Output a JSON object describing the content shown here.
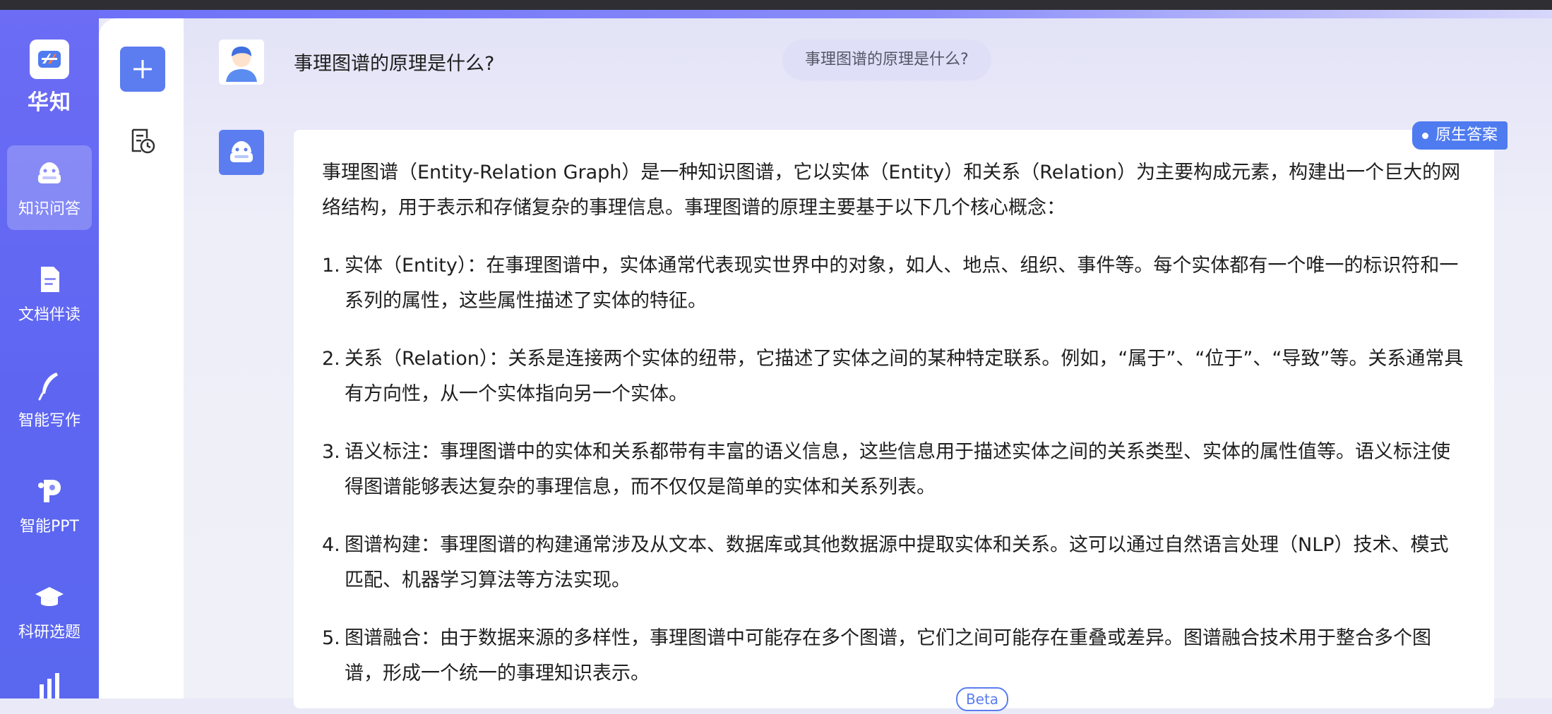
{
  "brand": {
    "name": "华知"
  },
  "sidebar": {
    "items": [
      {
        "label": "知识问答",
        "icon": "robot-icon",
        "active": true
      },
      {
        "label": "文档伴读",
        "icon": "document-icon"
      },
      {
        "label": "智能写作",
        "icon": "feather-pen-icon"
      },
      {
        "label": "智能PPT",
        "icon": "ppt-icon"
      },
      {
        "label": "科研选题",
        "icon": "graduation-cap-icon"
      }
    ]
  },
  "rail": {
    "new_icon": "plus-icon",
    "history_icon": "history-icon"
  },
  "conversation": {
    "question": "事理图谱的原理是什么?",
    "question_pill": "事理图谱的原理是什么?",
    "badge": "原生答案",
    "intro": "事理图谱（Entity-Relation Graph）是一种知识图谱，它以实体（Entity）和关系（Relation）为主要构成元素，构建出一个巨大的网络结构，用于表示和存储复杂的事理信息。事理图谱的原理主要基于以下几个核心概念：",
    "points": [
      {
        "num": "1.",
        "text": "实体（Entity）：在事理图谱中，实体通常代表现实世界中的对象，如人、地点、组织、事件等。每个实体都有一个唯一的标识符和一系列的属性，这些属性描述了实体的特征。"
      },
      {
        "num": "2.",
        "text": "关系（Relation）：关系是连接两个实体的纽带，它描述了实体之间的某种特定联系。例如，“属于”、“位于”、“导致”等。关系通常具有方向性，从一个实体指向另一个实体。"
      },
      {
        "num": "3.",
        "text": "语义标注：事理图谱中的实体和关系都带有丰富的语义信息，这些信息用于描述实体之间的关系类型、实体的属性值等。语义标注使得图谱能够表达复杂的事理信息，而不仅仅是简单的实体和关系列表。"
      },
      {
        "num": "4.",
        "text": "图谱构建：事理图谱的构建通常涉及从文本、数据库或其他数据源中提取实体和关系。这可以通过自然语言处理（NLP）技术、模式匹配、机器学习算法等方法实现。"
      },
      {
        "num": "5.",
        "text": "图谱融合：由于数据来源的多样性，事理图谱中可能存在多个图谱，它们之间可能存在重叠或差异。图谱融合技术用于整合多个图谱，形成一个统一的事理知识表示。"
      }
    ]
  },
  "beta_label": "Beta",
  "colors": {
    "primary": "#5b7df0",
    "sidebar": "#6268f2",
    "badge": "#4f7bf0"
  }
}
